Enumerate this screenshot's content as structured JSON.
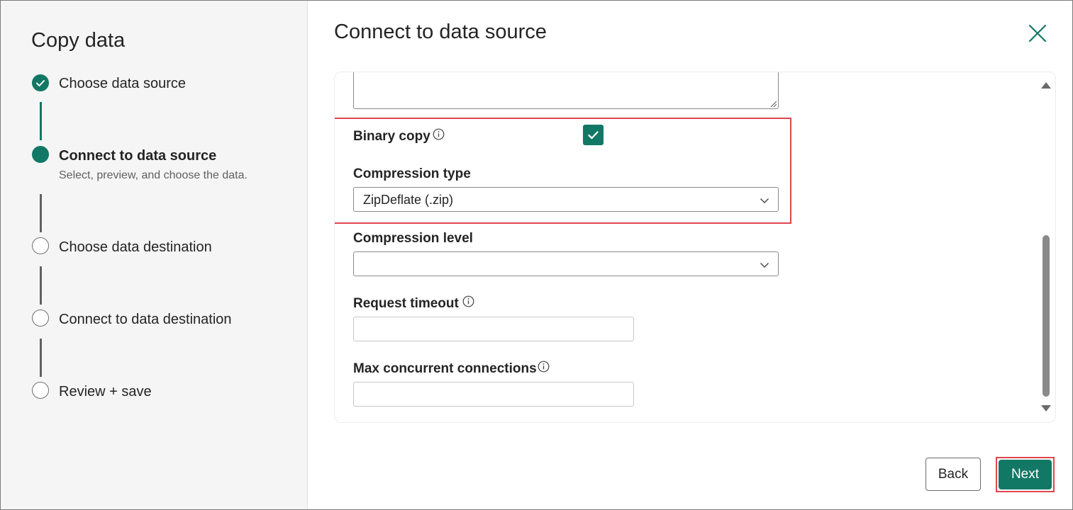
{
  "wizard": {
    "title": "Copy data",
    "steps": [
      {
        "label": "Choose data source",
        "state": "done"
      },
      {
        "label": "Connect to data source",
        "state": "current",
        "subtitle": "Select, preview, and choose the data."
      },
      {
        "label": "Choose data destination",
        "state": "pending"
      },
      {
        "label": "Connect to data destination",
        "state": "pending"
      },
      {
        "label": "Review + save",
        "state": "pending"
      }
    ]
  },
  "panel": {
    "title": "Connect to data source",
    "close_icon": "close-icon"
  },
  "form": {
    "binary_copy": {
      "label": "Binary copy",
      "checked": true
    },
    "compression_type": {
      "label": "Compression type",
      "value": "ZipDeflate (.zip)"
    },
    "compression_level": {
      "label": "Compression level",
      "value": ""
    },
    "request_timeout": {
      "label": "Request timeout",
      "value": ""
    },
    "max_concurrent": {
      "label": "Max concurrent connections",
      "value": ""
    }
  },
  "footer": {
    "back_label": "Back",
    "next_label": "Next"
  },
  "colors": {
    "accent": "#117865",
    "highlight": "#e0454d",
    "sidebar_bg": "#f5f5f5"
  }
}
